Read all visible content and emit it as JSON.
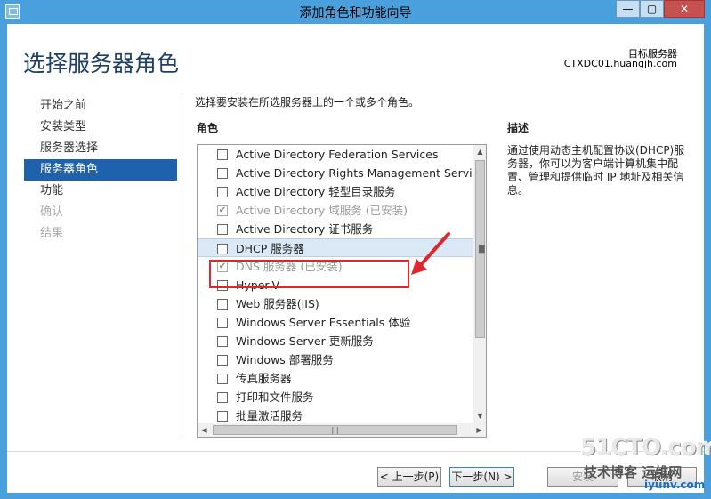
{
  "window": {
    "title": "添加角色和功能向导",
    "min_label": "—",
    "max_label": "▢",
    "close_label": "✕"
  },
  "header": {
    "page_title": "选择服务器角色",
    "target_label": "目标服务器",
    "target_name": "CTXDC01.huangjh.com"
  },
  "nav": {
    "items": [
      {
        "label": "开始之前",
        "state": "normal"
      },
      {
        "label": "安装类型",
        "state": "normal"
      },
      {
        "label": "服务器选择",
        "state": "normal"
      },
      {
        "label": "服务器角色",
        "state": "active"
      },
      {
        "label": "功能",
        "state": "normal"
      },
      {
        "label": "确认",
        "state": "disabled"
      },
      {
        "label": "结果",
        "state": "disabled"
      }
    ]
  },
  "main": {
    "instruction": "选择要安装在所选服务器上的一个或多个角色。",
    "roles_header": "角色",
    "desc_header": "描述",
    "description": "通过使用动态主机配置协议(DHCP)服务器，你可以为客户端计算机集中配置、管理和提供临时 IP 地址及相关信息。",
    "roles": [
      {
        "label": "Active Directory Federation Services",
        "checked": false,
        "disabled": false
      },
      {
        "label": "Active Directory Rights Management Services",
        "checked": false,
        "disabled": false
      },
      {
        "label": "Active Directory 轻型目录服务",
        "checked": false,
        "disabled": false
      },
      {
        "label": "Active Directory 域服务 (已安装)",
        "checked": true,
        "disabled": true
      },
      {
        "label": "Active Directory 证书服务",
        "checked": false,
        "disabled": false
      },
      {
        "label": "DHCP 服务器",
        "checked": false,
        "disabled": false,
        "selected": true
      },
      {
        "label": "DNS 服务器 (已安装)",
        "checked": true,
        "disabled": true
      },
      {
        "label": "Hyper-V",
        "checked": false,
        "disabled": false
      },
      {
        "label": "Web 服务器(IIS)",
        "checked": false,
        "disabled": false
      },
      {
        "label": "Windows Server Essentials 体验",
        "checked": false,
        "disabled": false
      },
      {
        "label": "Windows Server 更新服务",
        "checked": false,
        "disabled": false
      },
      {
        "label": "Windows 部署服务",
        "checked": false,
        "disabled": false
      },
      {
        "label": "传真服务器",
        "checked": false,
        "disabled": false
      },
      {
        "label": "打印和文件服务",
        "checked": false,
        "disabled": false
      },
      {
        "label": "批量激活服务",
        "checked": false,
        "disabled": false
      }
    ]
  },
  "buttons": {
    "prev": "< 上一步(P)",
    "next": "下一步(N) >",
    "install": "安装",
    "cancel": "取消"
  },
  "watermark": {
    "big": "51CTO.com",
    "small": "技术博客  运维网",
    "url": "iyunv.com"
  },
  "colors": {
    "accent": "#1e61ac",
    "titlebar": "#4aa0dc",
    "annotation": "#e0252d"
  }
}
